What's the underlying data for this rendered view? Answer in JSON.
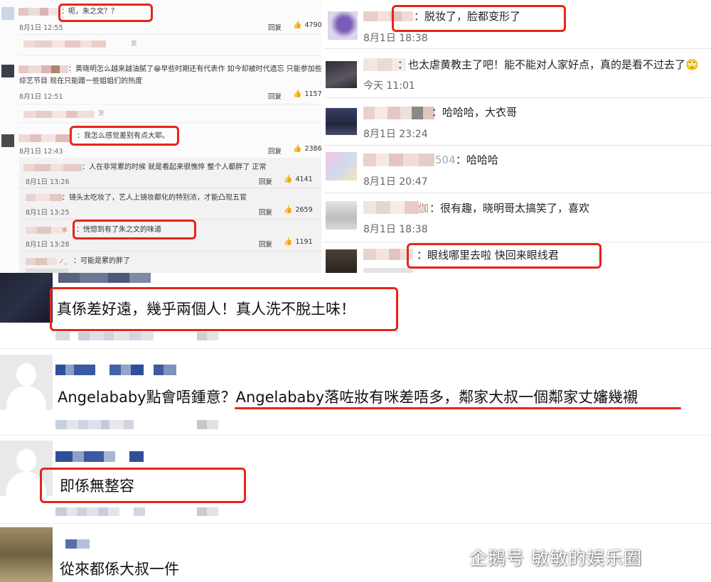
{
  "top_left": {
    "comments": [
      {
        "text": "：呃，朱之文？？",
        "date": "8月1日 12:55",
        "reply": "回复",
        "likes": "4790"
      },
      {
        "reply_stub": "复"
      },
      {
        "text": "：黄晓明怎么越来越油腻了😁早些时期还有代表作 如今却被时代遗忘 只能参加些",
        "text2": "综艺节目 现在只能蹭一些姐姐们的热度",
        "date": "8月1日 12:51",
        "reply": "回复",
        "likes": "1157"
      },
      {
        "reply_stub": "复"
      },
      {
        "text": "：我怎么感觉差别有点大耶。",
        "date": "8月1日 12:43",
        "reply": "回复",
        "likes": "2386"
      }
    ],
    "sub_replies": [
      {
        "text": "：人在非常累的时候 就是看起来很憔悴 整个人都胖了 正常",
        "date": "8月1日 13:26",
        "reply": "回复",
        "likes": "4141"
      },
      {
        "text": "：镜头太吃妆了，艺人上镜妆都化的特别浓，才能凸现五官",
        "date": "8月1日 13:25",
        "reply": "回复",
        "likes": "2659"
      },
      {
        "prefix": "水",
        "text": "：恍惚到有了朱之文的味道",
        "date": "8月1日 13:28",
        "reply": "回复",
        "likes": "1191"
      },
      {
        "prefix": "ノ_",
        "text": "：可能是累的胖了"
      }
    ]
  },
  "top_right": {
    "comments": [
      {
        "text": "：脱妆了，脸都变形了",
        "date": "8月1日 18:38"
      },
      {
        "text": "：也太虐黄教主了吧！能不能对人家好点，真的是看不过去了🙄",
        "date": "今天 11:01"
      },
      {
        "text": "：哈哈哈，大衣哥",
        "date": "8月1日 23:24"
      },
      {
        "prefix": "504",
        "text": "：哈哈哈",
        "date": "8月1日 20:47"
      },
      {
        "prefix": "伽",
        "text": "：很有趣，晓明哥太搞笑了，喜欢",
        "date": "8月1日 18:38"
      },
      {
        "text": "：眼线哪里去啦 快回来眼线君"
      }
    ]
  },
  "bottom": {
    "comments": [
      {
        "text": "真係差好遠，幾乎兩個人！真人洗不脫土味！"
      },
      {
        "text_a": "Angelababy點會唔鍾意？",
        "text_b": "Angelababy落咗妝有咪差唔多，鄰家大叔一個鄰家丈嬸幾襯"
      },
      {
        "text": "即係無整容"
      },
      {
        "text": "從來都係大叔一件"
      }
    ]
  },
  "watermark": {
    "text": "企鹅号 敏敏的娱乐圈",
    "icon": "penguin-icon"
  },
  "colors": {
    "highlight": "#e8241a",
    "blur_blue": "#2f4f9a"
  }
}
